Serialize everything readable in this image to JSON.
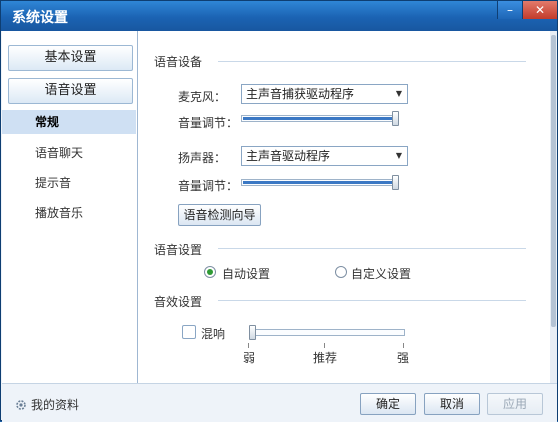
{
  "window": {
    "title": "系统设置",
    "minimize_icon": "minimize-icon",
    "close_icon": "close-icon"
  },
  "sidebar": {
    "group_basic": "基本设置",
    "group_voice": "语音设置",
    "items": [
      {
        "label": "常规",
        "active": true
      },
      {
        "label": "语音聊天",
        "active": false
      },
      {
        "label": "提示音",
        "active": false
      },
      {
        "label": "播放音乐",
        "active": false
      }
    ]
  },
  "voice_device": {
    "section_title": "语音设备",
    "mic_label": "麦克风：",
    "mic_value": "主声音捕获驱动程序",
    "mic_volume_label": "音量调节：",
    "mic_volume": 1.0,
    "speaker_label": "扬声器：",
    "speaker_value": "主声音驱动程序",
    "speaker_volume_label": "音量调节：",
    "speaker_volume": 1.0,
    "wizard_button": "语音检测向导"
  },
  "voice_settings": {
    "section_title": "语音设置",
    "auto_label": "自动设置",
    "custom_label": "自定义设置",
    "selected": "auto"
  },
  "sound_effects": {
    "section_title": "音效设置",
    "reverb_label": "混响",
    "reverb_checked": false,
    "reverb_level": 0.0,
    "scale_low": "弱",
    "scale_mid": "推荐",
    "scale_high": "强"
  },
  "footer": {
    "profile_link": "我的资料",
    "ok_button": "确定",
    "cancel_button": "取消",
    "apply_button": "应用"
  },
  "colors": {
    "title_bar": "#1b63b3",
    "accent": "#3b78c4",
    "radio_selected": "#2f9a35",
    "close": "#c23b2b"
  }
}
